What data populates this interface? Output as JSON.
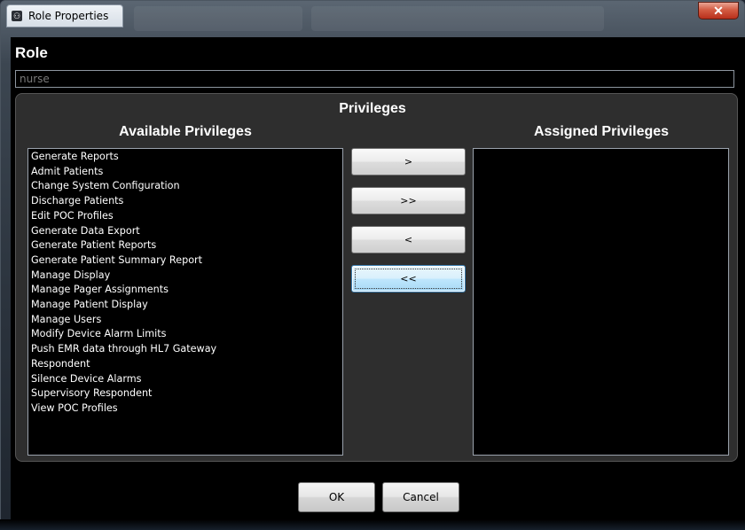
{
  "window": {
    "title": "Role Properties",
    "close_glyph": "✕"
  },
  "role": {
    "label": "Role",
    "value": "nurse"
  },
  "privileges": {
    "title": "Privileges",
    "available_title": "Available Privileges",
    "assigned_title": "Assigned Privileges",
    "available": [
      "Generate Reports",
      "Admit Patients",
      "Change System Configuration",
      "Discharge Patients",
      "Edit POC Profiles",
      "Generate Data Export",
      "Generate Patient Reports",
      "Generate Patient Summary Report",
      "Manage Display",
      "Manage Pager Assignments",
      "Manage Patient Display",
      "Manage Users",
      "Modify Device Alarm Limits",
      "Push EMR data through HL7 Gateway",
      "Respondent",
      "Silence Device Alarms",
      "Supervisory Respondent",
      "View POC Profiles"
    ],
    "assigned": []
  },
  "move_buttons": {
    "add": ">",
    "add_all": ">>",
    "remove": "<",
    "remove_all": "<<"
  },
  "dialog_buttons": {
    "ok": "OK",
    "cancel": "Cancel"
  }
}
